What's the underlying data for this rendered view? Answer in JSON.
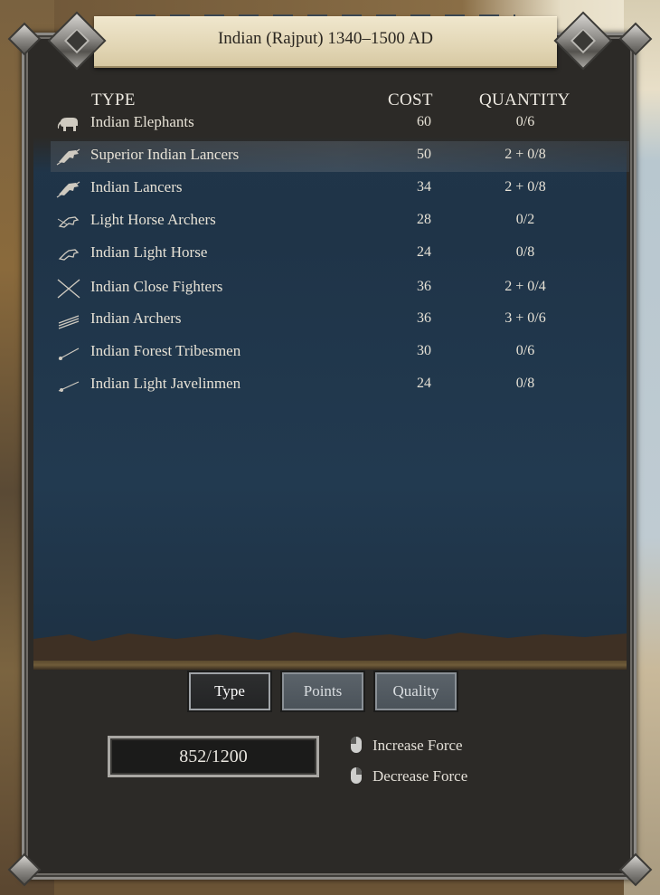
{
  "title": "Indian (Rajput) 1340–1500 AD",
  "headers": {
    "type": "TYPE",
    "cost": "COST",
    "quantity": "QUANTITY"
  },
  "units": [
    {
      "name": "Indian Elephants",
      "cost": "60",
      "quantity": "0/6",
      "icon": "elephant-icon",
      "selected": false
    },
    {
      "name": "Superior Indian Lancers",
      "cost": "50",
      "quantity": "2 + 0/8",
      "icon": "lancer-icon",
      "selected": true
    },
    {
      "name": "Indian Lancers",
      "cost": "34",
      "quantity": "2 + 0/8",
      "icon": "lancer-icon",
      "selected": false
    },
    {
      "name": "Light Horse Archers",
      "cost": "28",
      "quantity": "0/2",
      "icon": "horse-archer-icon",
      "selected": false
    },
    {
      "name": "Indian Light Horse",
      "cost": "24",
      "quantity": "0/8",
      "icon": "light-horse-icon",
      "selected": false
    },
    {
      "name": "Indian Close Fighters",
      "cost": "36",
      "quantity": "2 + 0/4",
      "icon": "crossed-swords-icon",
      "selected": false
    },
    {
      "name": "Indian Archers",
      "cost": "36",
      "quantity": "3 + 0/6",
      "icon": "arrows-icon",
      "selected": false
    },
    {
      "name": "Indian Forest Tribesmen",
      "cost": "30",
      "quantity": "0/6",
      "icon": "spear-icon",
      "selected": false
    },
    {
      "name": "Indian Light Javelinmen",
      "cost": "24",
      "quantity": "0/8",
      "icon": "javelin-icon",
      "selected": false
    }
  ],
  "sort_buttons": {
    "type": "Type",
    "points": "Points",
    "quality": "Quality",
    "active": "Type"
  },
  "points": "852/1200",
  "hints": {
    "increase": "Increase Force",
    "decrease": "Decrease Force"
  }
}
